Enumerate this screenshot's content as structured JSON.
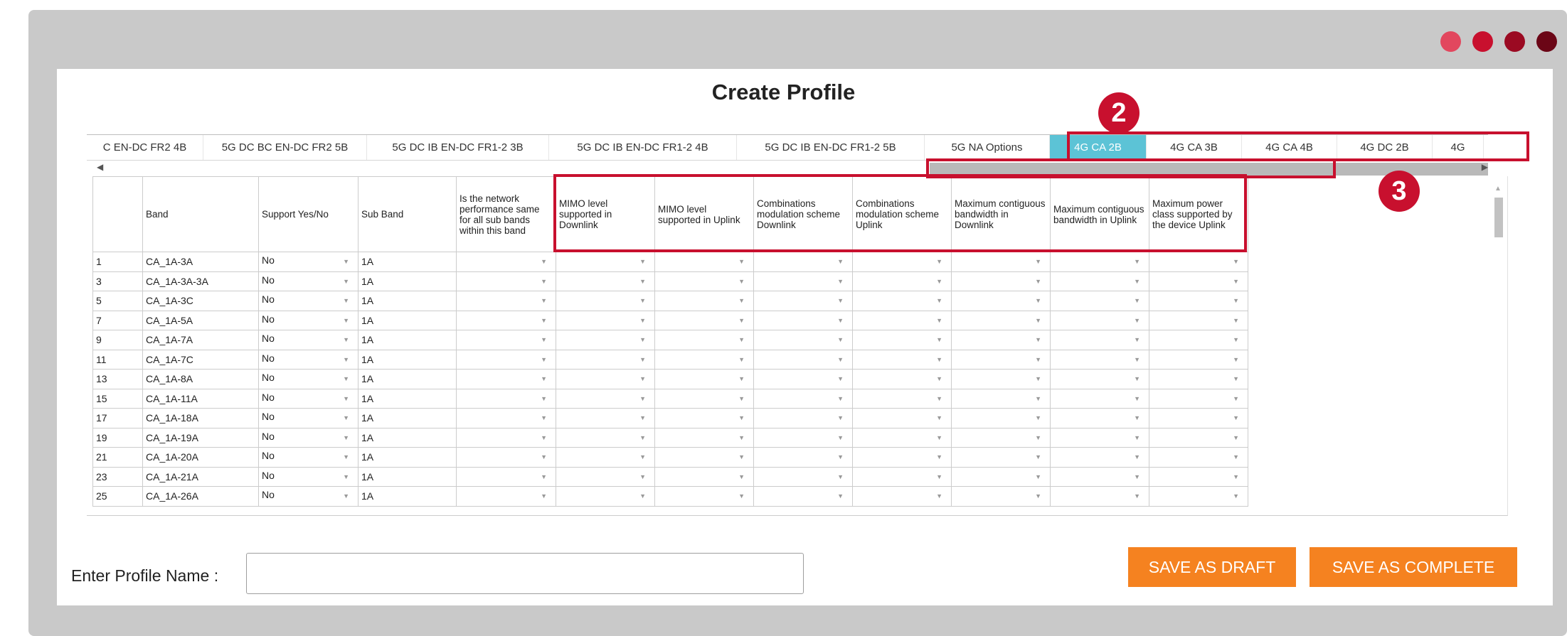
{
  "window": {
    "dots": [
      {
        "name": "dot-1",
        "color": "#e2475e"
      },
      {
        "name": "dot-2",
        "color": "#c8102e"
      },
      {
        "name": "dot-3",
        "color": "#9b0a22"
      },
      {
        "name": "dot-4",
        "color": "#6b0616"
      }
    ]
  },
  "page": {
    "title": "Create Profile"
  },
  "tabs": [
    {
      "label": "C EN-DC FR2 4B",
      "active": false
    },
    {
      "label": "5G DC BC EN-DC FR2 5B",
      "active": false
    },
    {
      "label": "5G DC IB EN-DC FR1-2 3B",
      "active": false
    },
    {
      "label": "5G DC IB EN-DC FR1-2 4B",
      "active": false
    },
    {
      "label": "5G DC IB EN-DC FR1-2 5B",
      "active": false
    },
    {
      "label": "5G NA Options",
      "active": false
    },
    {
      "label": "4G CA 2B",
      "active": true
    },
    {
      "label": "4G CA 3B",
      "active": false
    },
    {
      "label": "4G CA 4B",
      "active": false
    },
    {
      "label": "4G DC 2B",
      "active": false
    },
    {
      "label": "4G",
      "active": false
    }
  ],
  "grid": {
    "columns": [
      "",
      "Band",
      "Support Yes/No",
      "Sub Band",
      "Is the network performance same for all sub bands within this band",
      "MIMO level supported in Downlink",
      "MIMO level supported in Uplink",
      "Combinations modulation scheme Downlink",
      "Combinations modulation scheme Uplink",
      "Maximum contiguous bandwidth in Downlink",
      "Maximum contiguous bandwidth in Uplink",
      "Maximum power class supported by the device Uplink"
    ],
    "rows": [
      {
        "num": "1",
        "band": "CA_1A-3A",
        "support": "No",
        "sub_band": "1A"
      },
      {
        "num": "3",
        "band": "CA_1A-3A-3A",
        "support": "No",
        "sub_band": "1A"
      },
      {
        "num": "5",
        "band": "CA_1A-3C",
        "support": "No",
        "sub_band": "1A"
      },
      {
        "num": "7",
        "band": "CA_1A-5A",
        "support": "No",
        "sub_band": "1A"
      },
      {
        "num": "9",
        "band": "CA_1A-7A",
        "support": "No",
        "sub_band": "1A"
      },
      {
        "num": "11",
        "band": "CA_1A-7C",
        "support": "No",
        "sub_band": "1A"
      },
      {
        "num": "13",
        "band": "CA_1A-8A",
        "support": "No",
        "sub_band": "1A"
      },
      {
        "num": "15",
        "band": "CA_1A-11A",
        "support": "No",
        "sub_band": "1A"
      },
      {
        "num": "17",
        "band": "CA_1A-18A",
        "support": "No",
        "sub_band": "1A"
      },
      {
        "num": "19",
        "band": "CA_1A-19A",
        "support": "No",
        "sub_band": "1A"
      },
      {
        "num": "21",
        "band": "CA_1A-20A",
        "support": "No",
        "sub_band": "1A"
      },
      {
        "num": "23",
        "band": "CA_1A-21A",
        "support": "No",
        "sub_band": "1A"
      },
      {
        "num": "25",
        "band": "CA_1A-26A",
        "support": "No",
        "sub_band": "1A"
      }
    ]
  },
  "form": {
    "profile_label": "Enter Profile Name :",
    "profile_value": "",
    "save_draft_label": "SAVE AS DRAFT",
    "save_complete_label": "SAVE AS COMPLETE"
  },
  "annotations": {
    "badge_2": "2",
    "badge_3": "3",
    "callout_color": "#c8102e"
  },
  "colors": {
    "active_tab": "#5cc3d6",
    "button": "#f58220",
    "frame": "#c9c9c9"
  }
}
